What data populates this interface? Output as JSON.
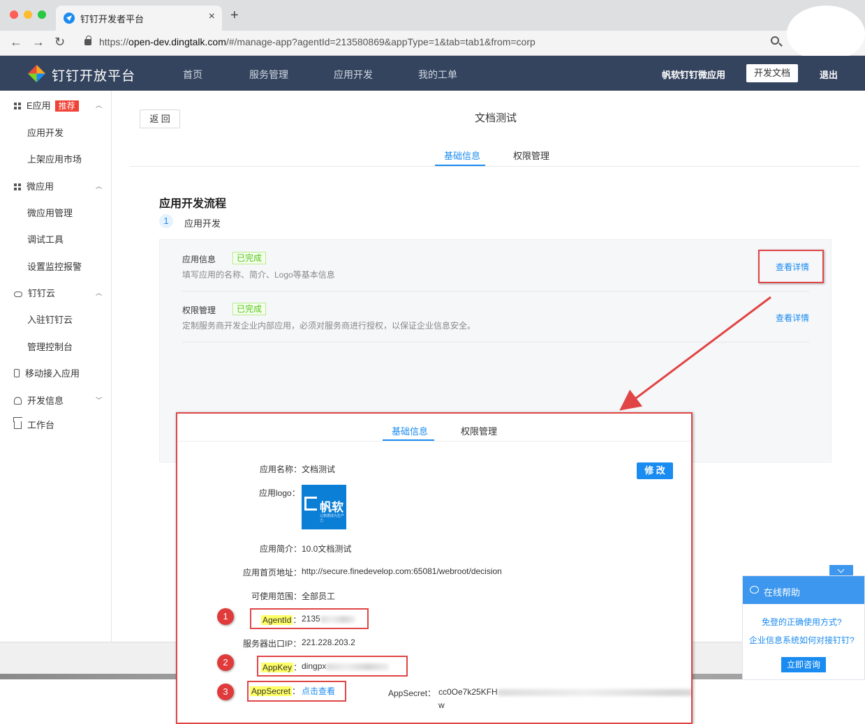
{
  "browser": {
    "tab_title": "钉钉开发者平台",
    "url_prefix": "https://",
    "url_host": "open-dev.dingtalk.com",
    "url_rest": "/#/manage-app?agentId=213580869&appType=1&tab=tab1&from=corp"
  },
  "header": {
    "logo_text": "钉钉开放平台",
    "nav": [
      "首页",
      "服务管理",
      "应用开发",
      "我的工单"
    ],
    "org_name": "帆软钉钉微应用",
    "doc_button": "开发文档",
    "logout": "退出"
  },
  "sidebar": {
    "groups": [
      {
        "label": "E应用",
        "badge": "推荐",
        "items": [
          "应用开发",
          "上架应用市场"
        ]
      },
      {
        "label": "微应用",
        "items": [
          "微应用管理",
          "调试工具",
          "设置监控报警"
        ]
      },
      {
        "label": "钉钉云",
        "items": [
          "入驻钉钉云",
          "管理控制台"
        ]
      },
      {
        "label": "移动接入应用"
      },
      {
        "label": "开发信息"
      },
      {
        "label": "工作台"
      }
    ]
  },
  "main": {
    "back_button": "返 回",
    "title": "文档测试",
    "tabs": [
      "基础信息",
      "权限管理"
    ],
    "section_title": "应用开发流程",
    "step_number": "1",
    "step_label": "应用开发",
    "rows": [
      {
        "title": "应用信息",
        "status": "已完成",
        "desc": "填写应用的名称、简介、Logo等基本信息",
        "link": "查看详情"
      },
      {
        "title": "权限管理",
        "status": "已完成",
        "desc": "定制服务商开发企业内部应用，必须对服务商进行授权，以保证企业信息安全。",
        "link": "查看详情"
      }
    ]
  },
  "popup": {
    "tabs": [
      "基础信息",
      "权限管理"
    ],
    "edit_button": "修 改",
    "logo_text": "帆软",
    "logo_subtext": "让数据成为生产力",
    "fields": {
      "name_label": "应用名称：",
      "name_value": "文档测试",
      "logo_label": "应用logo：",
      "intro_label": "应用简介：",
      "intro_value": "10.0文档测试",
      "homepage_label": "应用首页地址：",
      "homepage_value": "http://secure.finedevelop.com:65081/webroot/decision",
      "scope_label": "可使用范围：",
      "scope_value": "全部员工",
      "agentid_label": "AgentId",
      "agentid_value": "2135",
      "ip_label": "服务器出口IP：",
      "ip_value": "221.228.203.2",
      "appkey_label": "AppKey",
      "appkey_value": "dingpx",
      "appsecret_label": "AppSecret",
      "appsecret_link": "点击查看",
      "appsecret_reveal_label": "AppSecret：",
      "appsecret_reveal_value": "cc0Oe7k25KFH",
      "appsecret_reveal_tail": "w",
      "colon": "："
    },
    "markers": [
      "1",
      "2",
      "3"
    ]
  },
  "help": {
    "title": "在线帮助",
    "questions": [
      "免登的正确使用方式?",
      "企业信息系统如何对接钉钉?"
    ],
    "consult_button": "立即咨询"
  },
  "colors": {
    "header_bg": "#35445e",
    "accent": "#1a8bf0",
    "annotation_red": "#e04545",
    "highlight_yellow": "#ffff66",
    "done_green": "#52c41a"
  }
}
